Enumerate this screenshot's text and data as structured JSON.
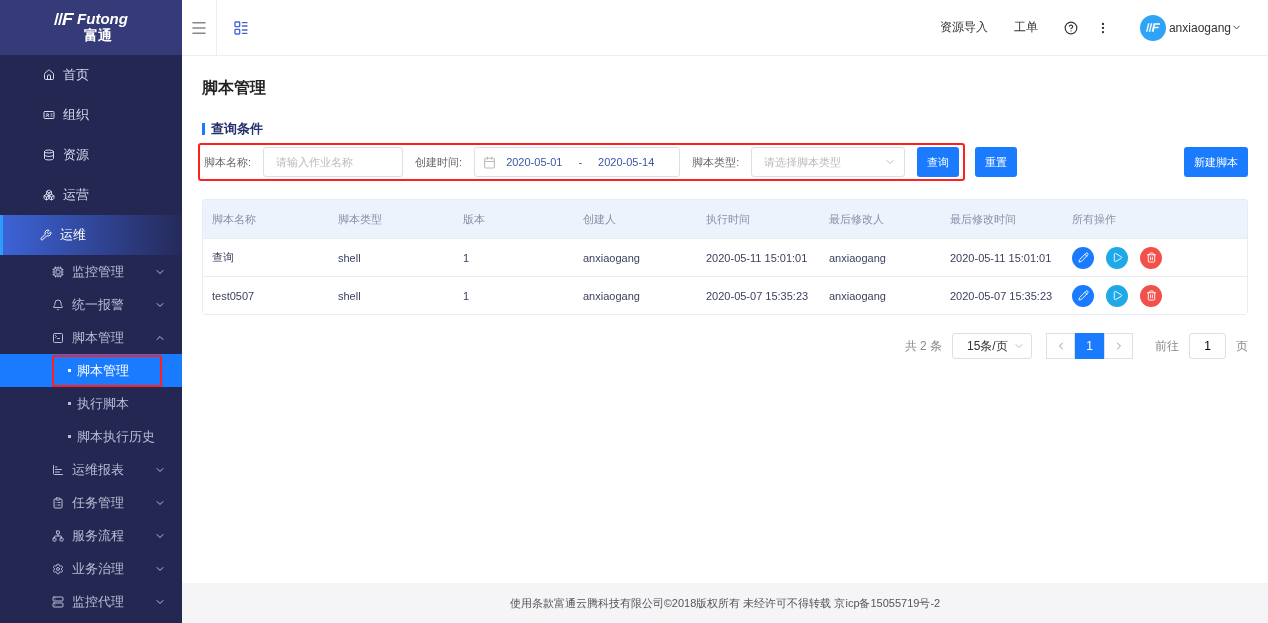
{
  "logo": {
    "brand": "Futong",
    "subtitle": "富通"
  },
  "sidebar": {
    "items": [
      {
        "label": "首页",
        "selected": false
      },
      {
        "label": "组织",
        "selected": false
      },
      {
        "label": "资源",
        "selected": false
      },
      {
        "label": "运营",
        "selected": false
      },
      {
        "label": "运维",
        "selected": true,
        "children": [
          {
            "label": "监控管理",
            "expanded": false
          },
          {
            "label": "统一报警",
            "expanded": false
          },
          {
            "label": "脚本管理",
            "expanded": true,
            "children": [
              {
                "label": "脚本管理",
                "selected": true,
                "annotated": true
              },
              {
                "label": "执行脚本",
                "selected": false,
                "annotated": false
              },
              {
                "label": "脚本执行历史",
                "selected": false,
                "annotated": false
              }
            ]
          },
          {
            "label": "运维报表",
            "expanded": false
          },
          {
            "label": "任务管理",
            "expanded": false
          },
          {
            "label": "服务流程",
            "expanded": false
          },
          {
            "label": "业务治理",
            "expanded": false
          },
          {
            "label": "监控代理",
            "expanded": false
          }
        ]
      }
    ]
  },
  "topbar": {
    "links": [
      "资源导入",
      "工单"
    ],
    "user": "anxiaogang"
  },
  "page_title": "脚本管理",
  "query": {
    "title": "查询条件",
    "annotated": true,
    "name_label": "脚本名称:",
    "name_placeholder": "请输入作业名称",
    "time_label": "创建时间:",
    "date_from": "2020-05-01",
    "date_sep": "-",
    "date_to": "2020-05-14",
    "type_label": "脚本类型:",
    "type_placeholder": "请选择脚本类型",
    "buttons": [
      "查询",
      "重置"
    ],
    "new_button": "新建脚本"
  },
  "table": {
    "columns": [
      "脚本名称",
      "脚本类型",
      "版本",
      "创建人",
      "执行时间",
      "最后修改人",
      "最后修改时间",
      "所有操作"
    ],
    "rows": [
      {
        "cells": [
          "查询",
          "shell",
          "1",
          "anxiaogang",
          "2020-05-11 15:01:01",
          "anxiaogang",
          "2020-05-11 15:01:01"
        ]
      },
      {
        "cells": [
          "test0507",
          "shell",
          "1",
          "anxiaogang",
          "2020-05-07 15:35:23",
          "anxiaogang",
          "2020-05-07 15:35:23"
        ]
      }
    ]
  },
  "pagination": {
    "total": "共 2 条",
    "page_size": "15条/页",
    "pages": [
      {
        "label": "1",
        "selected": true
      }
    ],
    "goto_label": "前往",
    "goto_value": "1",
    "goto_suffix": "页"
  },
  "footer": "使用条款富通云腾科技有限公司©2018版权所有 未经许可不得转载 京icp备15055719号-2"
}
